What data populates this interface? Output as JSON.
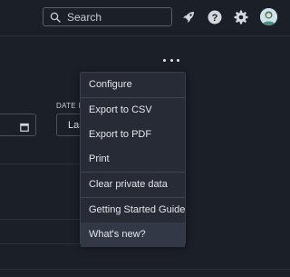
{
  "header": {
    "search": {
      "placeholder": "Search"
    },
    "icons": [
      "rocket-icon",
      "help-icon",
      "gear-icon"
    ]
  },
  "filters": {
    "date_range_label": "DATE RANGE",
    "date_range_value": "Last"
  },
  "menu": {
    "groups": [
      [
        "Configure"
      ],
      [
        "Export to CSV",
        "Export to PDF",
        "Print"
      ],
      [
        "Clear private data"
      ],
      [
        "Getting Started Guide",
        "What's new?"
      ]
    ],
    "items": {
      "configure": "Configure",
      "export_csv": "Export to CSV",
      "export_pdf": "Export to PDF",
      "print": "Print",
      "clear_private": "Clear private data",
      "getting_started": "Getting Started Guide",
      "whats_new": "What's new?"
    },
    "hovered_item": "What's new?"
  },
  "colors": {
    "background": "#1b1f28",
    "menu_background": "#262b35",
    "menu_hover": "#323845",
    "text": "#e4e6ea",
    "border": "#4a505b"
  }
}
